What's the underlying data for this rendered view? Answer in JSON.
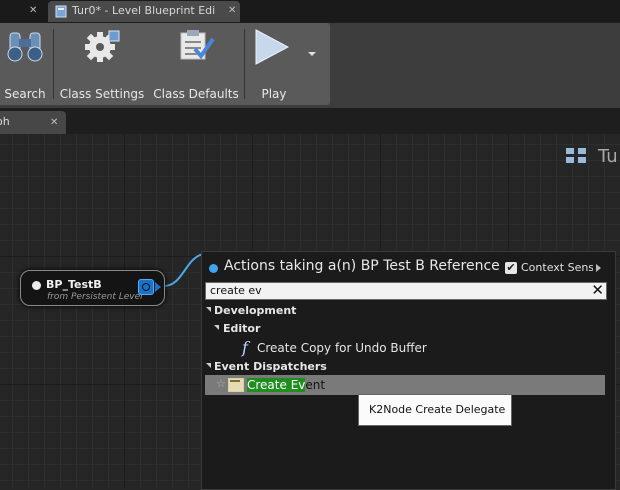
{
  "window_tabs": {
    "active_title": "Tur0* - Level Blueprint Edi"
  },
  "toolbar": {
    "buttons": [
      {
        "label": "Search",
        "icon": "binoculars-icon"
      },
      {
        "label": "Class Settings",
        "icon": "gear-icon"
      },
      {
        "label": "Class Defaults",
        "icon": "clipboard-check-icon"
      },
      {
        "label": "Play",
        "icon": "play-icon"
      }
    ]
  },
  "graph_tab": {
    "label": "oh"
  },
  "graph": {
    "watermark": "Tu",
    "node": {
      "title": "BP_TestB",
      "subtitle": "from Persistent Level"
    }
  },
  "actions_menu": {
    "title": "Actions taking a(n) BP Test B Reference",
    "context_label": "Context Sensitive",
    "context_checked": true,
    "search_value": "create ev",
    "tree": {
      "development": "Development",
      "editor": "Editor",
      "create_copy": "Create Copy for Undo Buffer",
      "event_dispatchers": "Event Dispatchers",
      "selected_item_match": "Create Ev",
      "selected_item_rest": "ent"
    }
  },
  "tooltip": {
    "text": "K2Node Create Delegate"
  },
  "colors": {
    "accent_blue": "#3fa3ee",
    "match_highlight": "#1f8e1f",
    "selection_row": "#7a7a7a"
  }
}
